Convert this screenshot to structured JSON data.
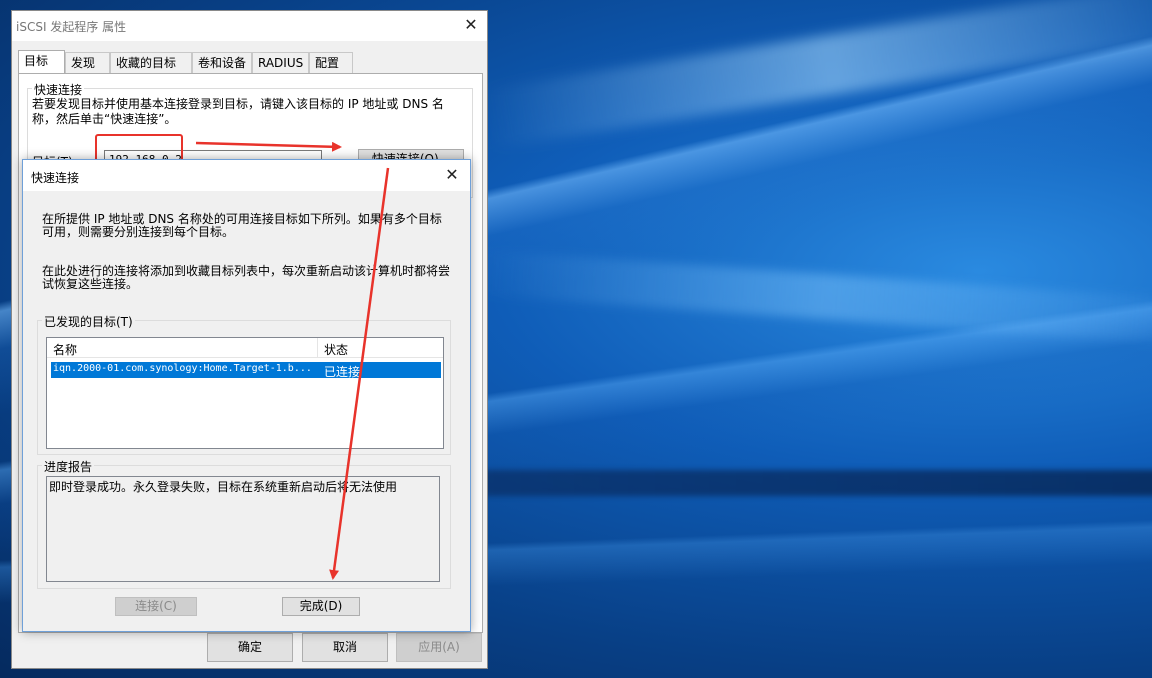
{
  "main_window": {
    "title": "iSCSI 发起程序 属性",
    "close_glyph": "✕",
    "tabs": [
      {
        "label": "目标"
      },
      {
        "label": "发现"
      },
      {
        "label": "收藏的目标"
      },
      {
        "label": "卷和设备"
      },
      {
        "label": "RADIUS"
      },
      {
        "label": "配置"
      }
    ],
    "quick_connect": {
      "legend": "快速连接",
      "description": "若要发现目标并使用基本连接登录到目标，请键入该目标的 IP 地址或 DNS 名称，然后单击“快速连接”。",
      "target_label": "目标(T):",
      "target_value": "192.168.0.2",
      "button_label": "快速连接(Q)..."
    },
    "footer": {
      "ok": "确定",
      "cancel": "取消",
      "apply": "应用(A)"
    }
  },
  "dialog": {
    "title": "快速连接",
    "close_glyph": "✕",
    "para1": "在所提供 IP 地址或 DNS 名称处的可用连接目标如下所列。如果有多个目标可用，则需要分别连接到每个目标。",
    "para2": "在此处进行的连接将添加到收藏目标列表中，每次重新启动该计算机时都将尝试恢复这些连接。",
    "found_legend": "已发现的目标(T)",
    "columns": {
      "name": "名称",
      "status": "状态"
    },
    "rows": [
      {
        "name": "iqn.2000-01.com.synology:Home.Target-1.b...",
        "status": "已连接"
      }
    ],
    "progress_legend": "进度报告",
    "progress_text": "即时登录成功。永久登录失败，目标在系统重新启动后将无法使用",
    "connect_button": "连接(C)",
    "done_button": "完成(D)"
  },
  "annotation_color": "#e8332b",
  "selection_color": "#0078d7"
}
